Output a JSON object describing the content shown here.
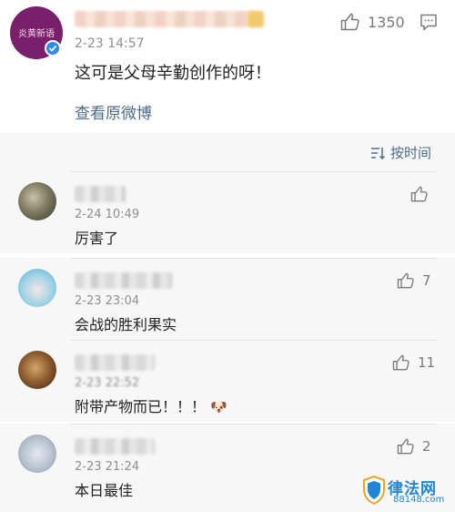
{
  "main_post": {
    "time": "2-23 14:57",
    "text": "这可是父母辛勤创作的呀！",
    "view_original": "查看原微博",
    "like_count": "1350",
    "avatar_text": "炎黄新语"
  },
  "sort": {
    "label": "按时间"
  },
  "replies": [
    {
      "time": "2-24 10:49",
      "text": "厉害了",
      "likes": ""
    },
    {
      "time": "2-23 23:04",
      "text": "会战的胜利果实",
      "likes": "7"
    },
    {
      "time": "2-23 22:52",
      "text": "附带产物而已！！！",
      "emoji": "🐶",
      "likes": "11"
    },
    {
      "time": "2-23 21:24",
      "text": "本日最佳",
      "likes": "2"
    }
  ],
  "watermark": {
    "title": "律法网",
    "subtitle": "88148.com"
  },
  "colors": {
    "link": "#4d6b8a",
    "reply_bg": "#f7f7f7",
    "verified": "#2a8cf0",
    "watermark": "#1f86d6"
  },
  "icons": [
    "thumbs-up-icon",
    "comment-icon",
    "sort-icon",
    "verified-icon",
    "shield-icon"
  ]
}
